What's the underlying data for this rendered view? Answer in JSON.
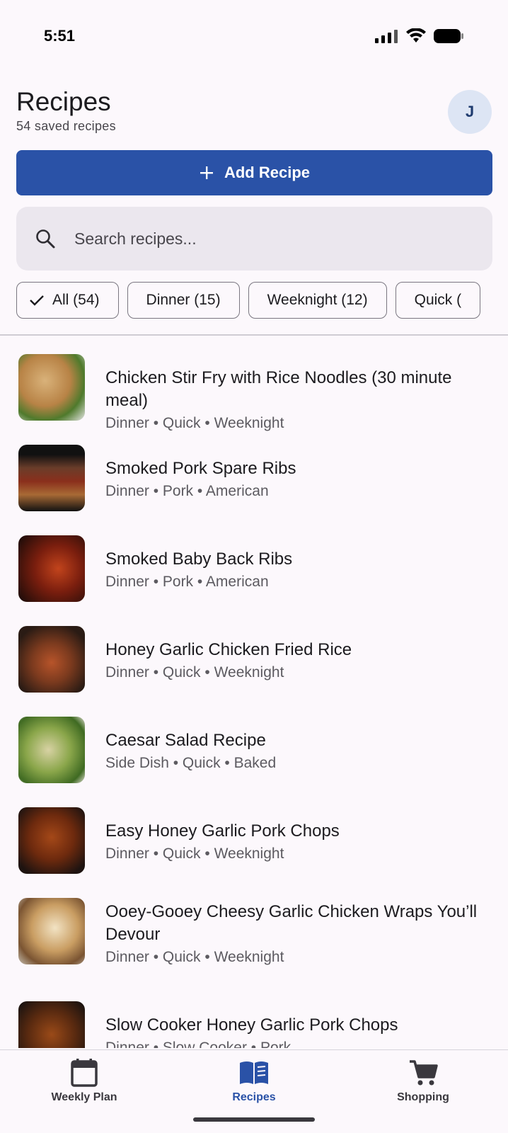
{
  "status_bar": {
    "time": "5:51"
  },
  "header": {
    "title": "Recipes",
    "subtitle": "54 saved recipes",
    "avatar_initial": "J"
  },
  "add_button": {
    "label": "Add Recipe",
    "icon": "plus-icon"
  },
  "search": {
    "placeholder": "Search recipes...",
    "value": "",
    "icon": "search-icon"
  },
  "filters": [
    {
      "label": "All (54)",
      "selected": true
    },
    {
      "label": "Dinner (15)",
      "selected": false
    },
    {
      "label": "Weeknight (12)",
      "selected": false
    },
    {
      "label": "Quick (",
      "selected": false
    }
  ],
  "recipes": [
    {
      "title": "Chicken Stir Fry with Rice Noodles (30 minute meal)",
      "tags": "Dinner • Quick • Weeknight"
    },
    {
      "title": "Smoked Pork Spare Ribs",
      "tags": "Dinner • Pork • American"
    },
    {
      "title": "Smoked Baby Back Ribs",
      "tags": "Dinner • Pork • American"
    },
    {
      "title": "Honey Garlic Chicken Fried Rice",
      "tags": "Dinner • Quick • Weeknight"
    },
    {
      "title": "Caesar Salad Recipe",
      "tags": "Side Dish • Quick • Baked"
    },
    {
      "title": "Easy Honey Garlic Pork Chops",
      "tags": "Dinner • Quick • Weeknight"
    },
    {
      "title": "Ooey-Gooey Cheesy Garlic Chicken Wraps You’ll Devour",
      "tags": "Dinner • Quick • Weeknight"
    },
    {
      "title": "Slow Cooker Honey Garlic Pork Chops",
      "tags": "Dinner • Slow Cooker • Pork"
    }
  ],
  "bottom_nav": [
    {
      "label": "Weekly Plan",
      "icon": "calendar-icon",
      "active": false
    },
    {
      "label": "Recipes",
      "icon": "book-icon",
      "active": true
    },
    {
      "label": "Shopping",
      "icon": "cart-icon",
      "active": false
    }
  ],
  "colors": {
    "accent": "#2a52a7",
    "background": "#fcf8fc",
    "search_bg": "#ebe7ee",
    "avatar_bg": "#dde5f4"
  }
}
